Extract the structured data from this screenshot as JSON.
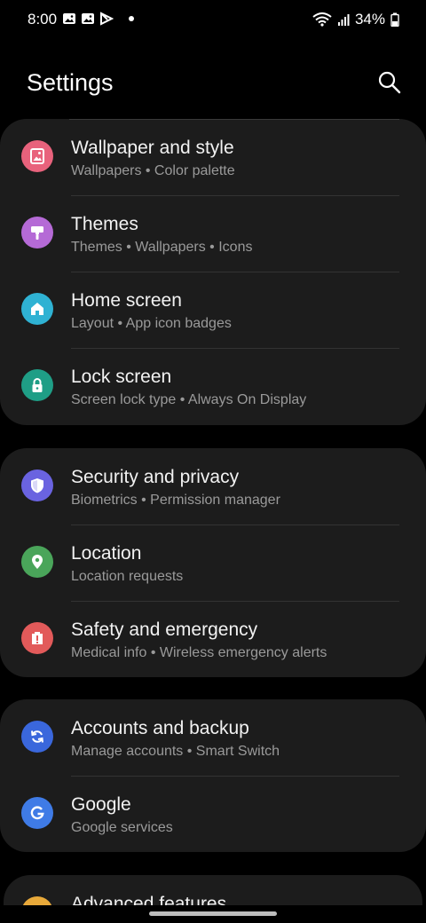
{
  "status_bar": {
    "time": "8:00",
    "battery": "34%",
    "left_icons": [
      "gallery-icon",
      "gallery-icon",
      "play-store-icon"
    ],
    "right_icons": [
      "wifi-icon",
      "signal-icon",
      "battery-icon"
    ]
  },
  "header": {
    "title": "Settings",
    "search_icon": "search-icon"
  },
  "groups": [
    {
      "items": [
        {
          "title": "Wallpaper and style",
          "subtitle": "Wallpapers  •  Color palette",
          "icon": "wallpaper-icon",
          "color": "#e8627c"
        },
        {
          "title": "Themes",
          "subtitle": "Themes  •  Wallpapers  •  Icons",
          "icon": "themes-brush-icon",
          "color": "#b56ad6"
        },
        {
          "title": "Home screen",
          "subtitle": "Layout  •  App icon badges",
          "icon": "home-icon",
          "color": "#2fb2d3"
        },
        {
          "title": "Lock screen",
          "subtitle": "Screen lock type  •  Always On Display",
          "icon": "lock-icon",
          "color": "#1f9e86"
        }
      ]
    },
    {
      "items": [
        {
          "title": "Security and privacy",
          "subtitle": "Biometrics  •  Permission manager",
          "icon": "shield-icon",
          "color": "#6a63e0"
        },
        {
          "title": "Location",
          "subtitle": "Location requests",
          "icon": "location-pin-icon",
          "color": "#4aa55a"
        },
        {
          "title": "Safety and emergency",
          "subtitle": "Medical info  •  Wireless emergency alerts",
          "icon": "alert-icon",
          "color": "#e25a5a"
        }
      ]
    },
    {
      "items": [
        {
          "title": "Accounts and backup",
          "subtitle": "Manage accounts  •  Smart Switch",
          "icon": "sync-icon",
          "color": "#3a67dc"
        },
        {
          "title": "Google",
          "subtitle": "Google services",
          "icon": "google-icon",
          "color": "#3f7be6"
        }
      ]
    },
    {
      "items": [
        {
          "title": "Advanced features",
          "subtitle": "",
          "icon": "advanced-features-icon",
          "color": "#e8a93a"
        }
      ]
    }
  ]
}
